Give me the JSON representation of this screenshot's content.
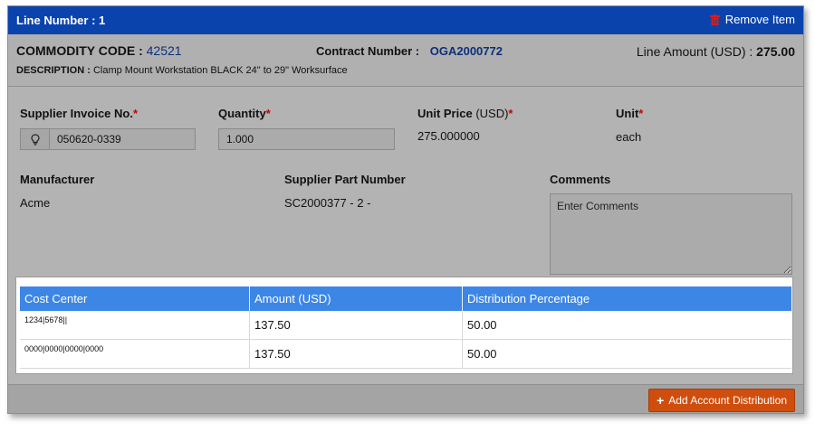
{
  "titlebar": {
    "title": "Line Number : 1",
    "remove_label": "Remove Item"
  },
  "header": {
    "commodity_label": "COMMODITY CODE :",
    "commodity_value": "42521",
    "description_label": "DESCRIPTION :",
    "description_value": "Clamp Mount Workstation BLACK 24\" to 29\" Worksurface",
    "contract_label": "Contract Number :",
    "contract_value": "OGA2000772",
    "line_amount_label": "Line Amount (USD) :",
    "line_amount_value": "275.00"
  },
  "fields": {
    "invoice_label": "Supplier Invoice No.",
    "invoice_value": "050620-0339",
    "quantity_label": "Quantity",
    "quantity_value": "1.000",
    "unit_price_label": "Unit Price",
    "unit_price_suffix": "(USD)",
    "unit_price_value": "275.000000",
    "unit_label": "Unit",
    "unit_value": "each",
    "manufacturer_label": "Manufacturer",
    "manufacturer_value": "Acme",
    "supplier_part_label": "Supplier Part Number",
    "supplier_part_value": "SC2000377 - 2 -",
    "comments_label": "Comments",
    "comments_placeholder": "Enter Comments",
    "required_mark": "*"
  },
  "distribution_table": {
    "headers": [
      "Cost Center",
      "Amount (USD)",
      "Distribution Percentage"
    ],
    "rows": [
      {
        "cost_center": "1234|5678||",
        "amount": "137.50",
        "percentage": "50.00"
      },
      {
        "cost_center": "0000|0000|0000|0000",
        "amount": "137.50",
        "percentage": "50.00"
      }
    ]
  },
  "footer": {
    "add_button_label": "Add Account Distribution"
  },
  "icons": {
    "remove": "trash-icon",
    "invoice_addon": "lightbulb-icon",
    "add": "plus-icon"
  },
  "colors": {
    "titlebar": "#0b43ad",
    "table_header": "#3c86e6",
    "add_button": "#cf4e0e",
    "required": "#cc0000",
    "trash_icon": "#d21f1f"
  }
}
